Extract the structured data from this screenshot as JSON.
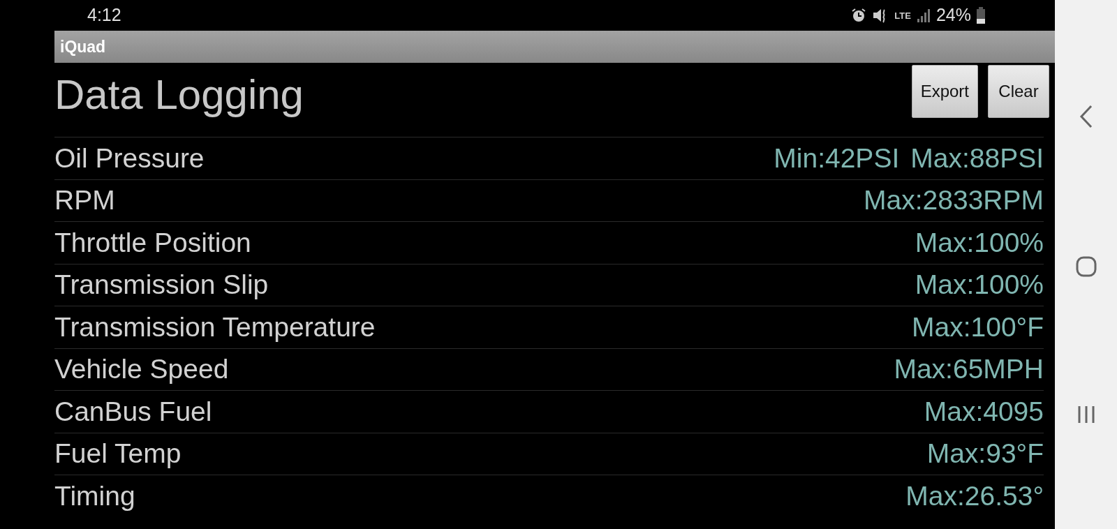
{
  "status_bar": {
    "time": "4:12",
    "battery_text": "24%",
    "network": "LTE"
  },
  "app_bar": {
    "title": "iQuad"
  },
  "header": {
    "title": "Data Logging",
    "buttons": [
      "Export",
      "Clear"
    ]
  },
  "rows": [
    {
      "name": "Oil Pressure",
      "values": [
        "Min:42PSI",
        "Max:88PSI"
      ]
    },
    {
      "name": "RPM",
      "values": [
        "Max:2833RPM"
      ]
    },
    {
      "name": "Throttle Position",
      "values": [
        "Max:100%"
      ]
    },
    {
      "name": "Transmission Slip",
      "values": [
        "Max:100%"
      ]
    },
    {
      "name": "Transmission Temperature",
      "values": [
        "Max:100°F"
      ]
    },
    {
      "name": "Vehicle Speed",
      "values": [
        "Max:65MPH"
      ]
    },
    {
      "name": "CanBus Fuel",
      "values": [
        "Max:4095"
      ]
    },
    {
      "name": "Fuel Temp",
      "values": [
        "Max:93°F"
      ]
    },
    {
      "name": "Timing",
      "values": [
        "Max:26.53°"
      ]
    }
  ]
}
